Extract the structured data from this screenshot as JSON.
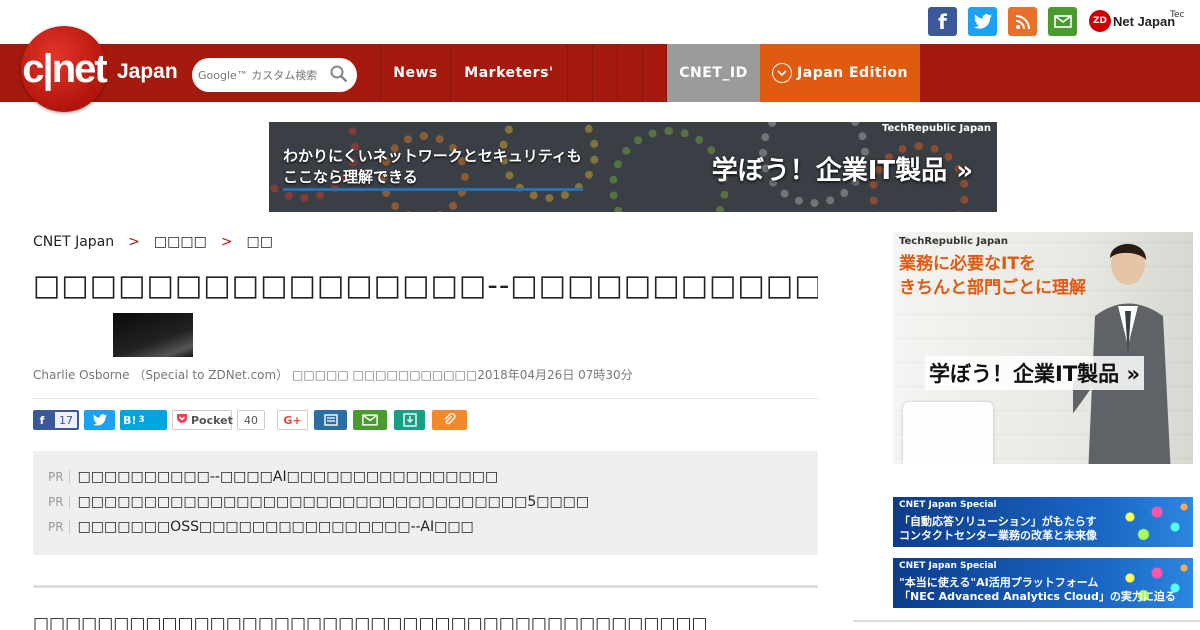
{
  "header": {
    "logo_text": "c|net",
    "logo_sub": "Japan",
    "search_placeholder": "Google™ カスタム検索",
    "nav": {
      "news": "News",
      "marketers": "Marketers'",
      "cnet_id": "CNET_ID",
      "edition": "Japan Edition"
    },
    "utility": {
      "zdnet_label": "Net Japan",
      "zdnet_badge": "ZD",
      "techrepublic_label": "Tec"
    }
  },
  "banner": {
    "brand": "TechRepublic Japan",
    "text_line1": "わかりにくいネットワークとセキュリティも",
    "text_line2": "ここなら理解できる",
    "cta": "学ぼう！企業IT製品 »"
  },
  "breadcrumb": {
    "home": "CNET Japan",
    "sep": ">",
    "level1": "□□□□",
    "level2": "□□"
  },
  "article": {
    "headline": "□□□□□□□□□□□□□□□□--□□□□□□□□□□□□□□□□□",
    "byline": "Charlie Osborne （Special to ZDNet.com） □□□□□ □□□□□□□□□□□2018年04月26日 07時30分",
    "lead": "□□□□□□□□□□□□□□□□□□□□□□□□□□□□□□□□□□□□□□□□□□"
  },
  "share": {
    "facebook_count": "17",
    "hatena_label": "B!",
    "hatena_count": "3",
    "pocket_label": "Pocket",
    "pocket_count": "40",
    "gplus_label": "G+"
  },
  "pr": {
    "tag": "PR",
    "items": [
      "□□□□□□□□□□--□□□□AI□□□□□□□□□□□□□□□□",
      "□□□□□□□□□□□□□□□□□□□□□□□□□□□□□□□□□□5□□□□",
      "□□□□□□□OSS□□□□□□□□□□□□□□□□--AI□□□"
    ]
  },
  "sidebar": {
    "ad_brand": "TechRepublic Japan",
    "ad_msg_line1": "業務に必要なITを",
    "ad_msg_line2": "きちんと部門ごとに理解",
    "ad_cta": "学ぼう！企業IT製品 »",
    "small1": {
      "brand": "CNET Japan Special",
      "line1": "「自動応答ソリューション」がもたらす",
      "line2": "コンタクトセンター業務の改革と未来像"
    },
    "small2": {
      "brand": "CNET Japan Special",
      "line1": "\"本当に使える\"AI活用プラットフォーム",
      "line2": "「NEC Advanced Analytics Cloud」の実力に迫る"
    }
  },
  "colors": {
    "brand_red": "#a5190e",
    "edition_orange": "#e05a10",
    "cnet_id_gray": "#9b9b9b"
  }
}
